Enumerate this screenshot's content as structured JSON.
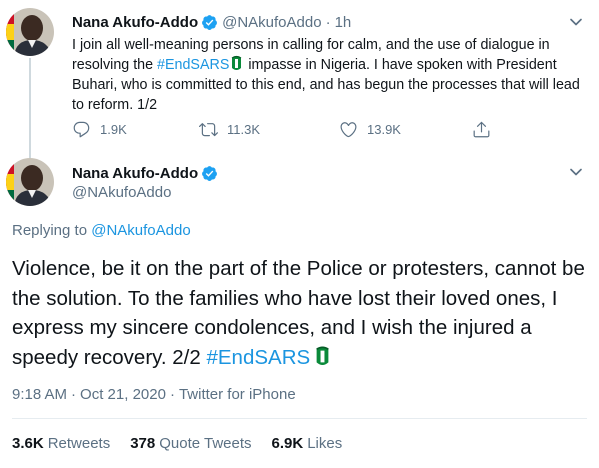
{
  "tweet1": {
    "author_name": "Nana Akufo-Addo",
    "author_handle": "@NAkufoAddo",
    "separator": "·",
    "time": "1h",
    "text_before": "I join all well-meaning persons in calling for calm, and the use of dialogue in resolving the ",
    "hashtag": "#EndSARS",
    "text_after": " impasse in Nigeria. I have spoken with President Buhari, who is committed to this end, and has begun the processes that will lead to reform. 1/2",
    "replies": "1.9K",
    "retweets": "11.3K",
    "likes": "13.9K"
  },
  "tweet2": {
    "author_name": "Nana Akufo-Addo",
    "author_handle": "@NAkufoAddo",
    "replying_prefix": "Replying to ",
    "replying_to": "@NAkufoAddo",
    "text": "Violence, be it on the part of the Police or protesters, cannot be the solution. To the families who have lost their loved ones, I express my sincere condolences, and I wish the injured a speedy recovery. 2/2 ",
    "hashtag": "#EndSARS",
    "time": "9:18 AM",
    "separator": "·",
    "date": "Oct 21, 2020",
    "source": "Twitter for iPhone",
    "retweets_count": "3.6K",
    "retweets_label": "Retweets",
    "quote_count": "378",
    "quote_label": "Quote Tweets",
    "likes_count": "6.9K",
    "likes_label": "Likes"
  },
  "icons": {
    "verified": "verified-badge-icon",
    "caret": "chevron-down-icon",
    "reply": "reply-icon",
    "retweet": "retweet-icon",
    "like": "heart-icon",
    "share": "share-icon",
    "emoji": "nigeria-flag-emoji"
  },
  "colors": {
    "link": "#1b95e0",
    "verified": "#1da1f2",
    "muted": "#5b7083",
    "text": "#0f1419"
  }
}
